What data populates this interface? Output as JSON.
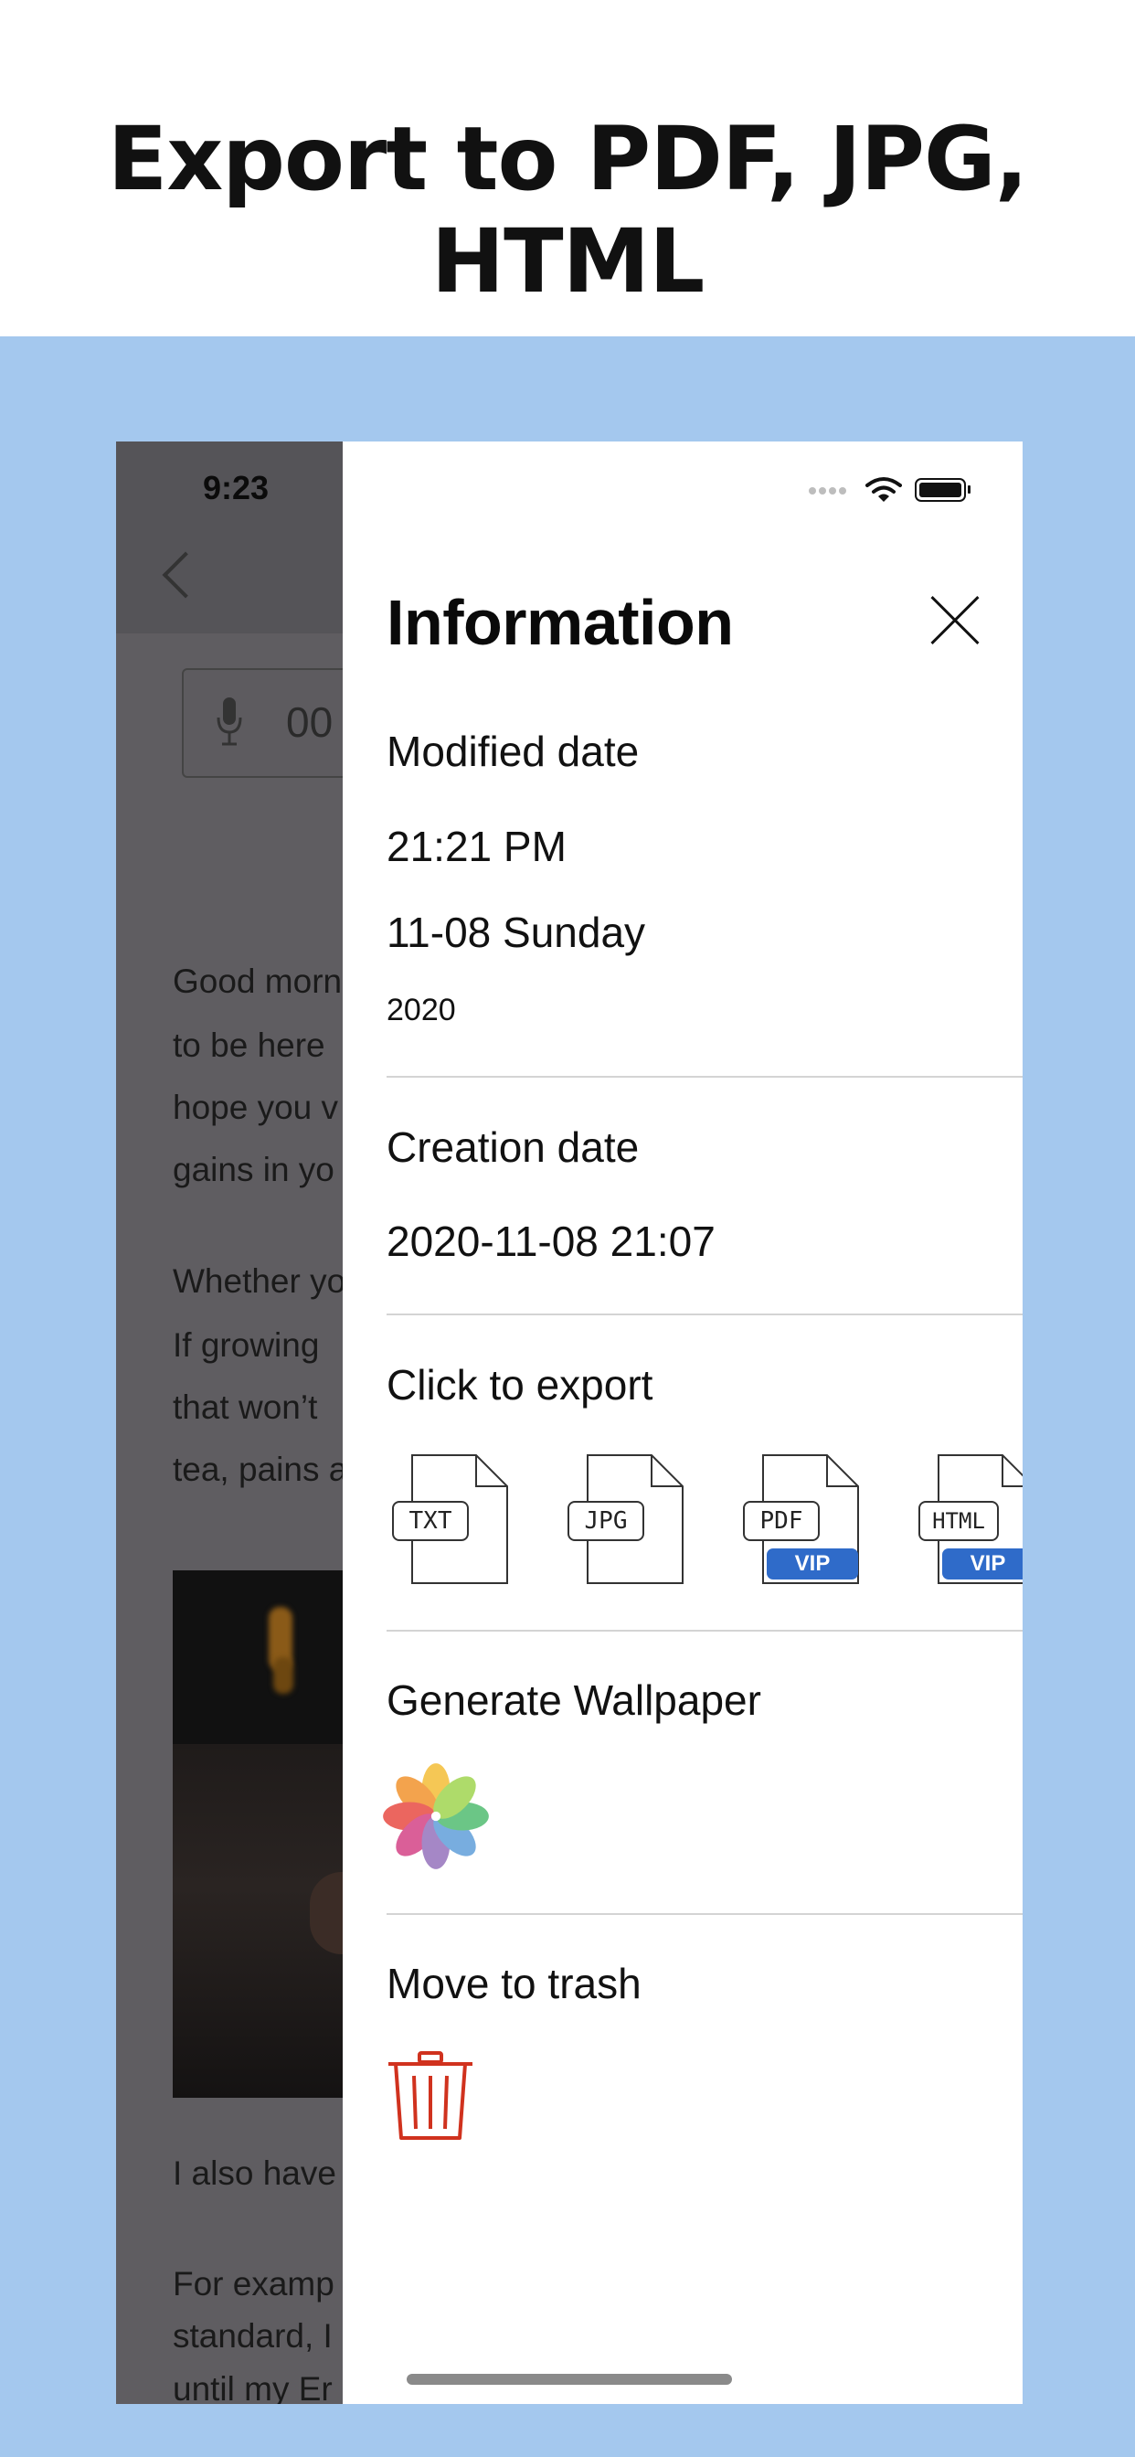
{
  "promo": {
    "title": "Export to PDF, JPG, HTML"
  },
  "background_note": {
    "status_time": "9:23",
    "audio_time": "00",
    "text_lines": [
      "Good morn",
      "to be here",
      "hope you v",
      "gains in yo",
      "Whether yo",
      "If growing",
      "that won’t",
      "tea, pains a",
      "I also have",
      "For examp",
      "standard, I",
      "until my Er"
    ]
  },
  "panel": {
    "title": "Information",
    "modified": {
      "label": "Modified date",
      "time": "21:21 PM",
      "date": "11-08 Sunday",
      "year": "2020"
    },
    "created": {
      "label": "Creation date",
      "value": "2020-11-08 21:07"
    },
    "export": {
      "label": "Click to export",
      "items": [
        {
          "tag": "TXT",
          "vip": ""
        },
        {
          "tag": "JPG",
          "vip": ""
        },
        {
          "tag": "PDF",
          "vip": "VIP"
        },
        {
          "tag": "HTML",
          "vip": "VIP"
        }
      ]
    },
    "wallpaper": {
      "label": "Generate Wallpaper",
      "icon": "photos-icon"
    },
    "trash": {
      "label": "Move to trash",
      "icon": "trash-icon",
      "color": "#d0321e"
    }
  },
  "colors": {
    "band": "#a4c8ee",
    "vip": "#2f6bc9",
    "dim": "#5f5d61"
  }
}
